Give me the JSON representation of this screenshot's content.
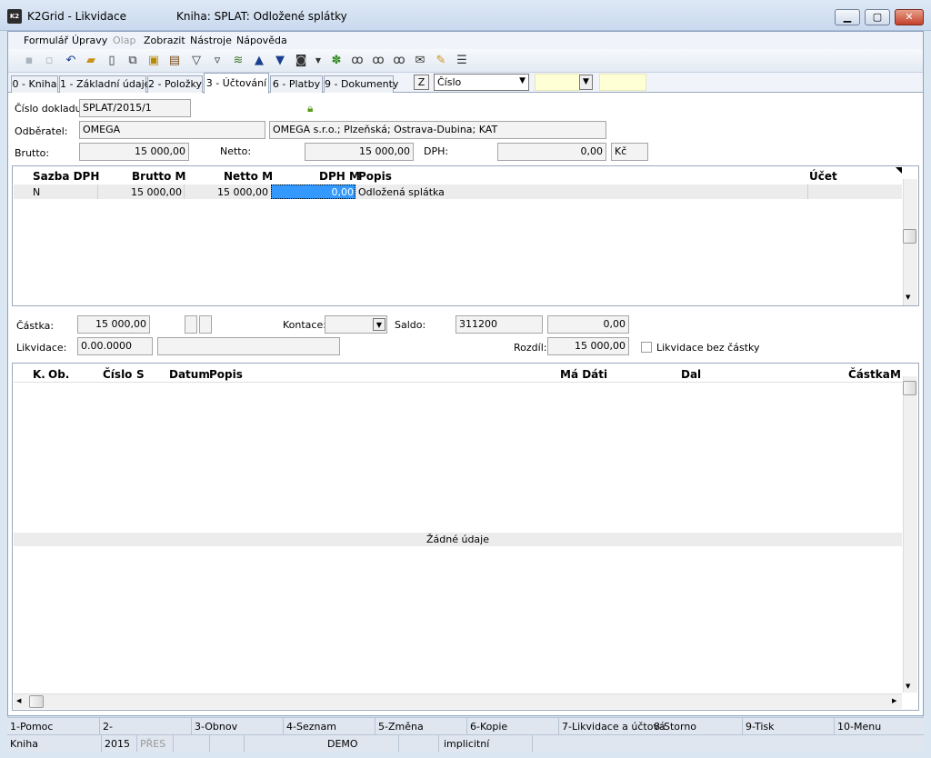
{
  "window": {
    "app_title": "K2Grid - Likvidace",
    "doc_title": "Kniha: SPLAT: Odložené splátky",
    "app_icon_text": "K2"
  },
  "menu": [
    "Formulář",
    "Úpravy",
    "Olap",
    "Zobrazit",
    "Nástroje",
    "Nápověda"
  ],
  "toolbar_icons": [
    "save-icon",
    "save-as-icon",
    "undo-icon",
    "open-icon",
    "new-icon",
    "copy-icon",
    "lock-icon",
    "book-icon",
    "filter-icon",
    "filter-doc-icon",
    "stack-icon",
    "arrow-up-icon",
    "arrow-down-icon",
    "camera-icon",
    "dropdown-icon",
    "plant-icon",
    "binoculars-icon",
    "binoculars-next-icon",
    "binoculars-settings-icon",
    "mail-icon",
    "notes-icon",
    "menu-lines-icon"
  ],
  "tabs": {
    "t0": "0 - Kniha",
    "t1": "1 - Základní údaje",
    "t2": "2 - Položky",
    "t3": "3 - Účtování",
    "t6": "6 - Platby",
    "t9": "9 - Dokumenty",
    "z_button": "Z",
    "sort_select": "Číslo"
  },
  "header": {
    "doc_number_label": "Číslo dokladu:",
    "doc_number": "SPLAT/2015/1",
    "customer_label": "Odběratel:",
    "customer_code": "OMEGA",
    "customer_name": "OMEGA s.r.o.; Plzeňská; Ostrava-Dubina; KAT",
    "brutto_label": "Brutto:",
    "brutto": "15 000,00",
    "netto_label": "Netto:",
    "netto": "15 000,00",
    "dph_label": "DPH:",
    "dph": "0,00",
    "currency": "Kč"
  },
  "grid1": {
    "columns": [
      "Sazba DPH",
      "Brutto M",
      "Netto M",
      "DPH M",
      "Popis",
      "Účet"
    ],
    "rows": [
      {
        "sazba": "N",
        "brutto": "15 000,00",
        "netto": "15 000,00",
        "dph": "0,00",
        "popis": "Odložená splátka",
        "ucet": ""
      }
    ]
  },
  "liquidation": {
    "castka_label": "Částka:",
    "castka": "15 000,00",
    "kontace_label": "Kontace:",
    "saldo_label": "Saldo:",
    "saldo_account": "311200",
    "saldo_value": "0,00",
    "likvidace_label": "Likvidace:",
    "likvidace": "0.00.0000",
    "rozdil_label": "Rozdíl:",
    "rozdil": "15 000,00",
    "checkbox_label": "Likvidace bez částky"
  },
  "grid2": {
    "columns": [
      "K.",
      "Ob.",
      "Číslo",
      "S",
      "Datum",
      "Popis",
      "Má Dáti",
      "Dal",
      "Částka",
      "M"
    ],
    "empty_text": "Žádné údaje"
  },
  "fkeys": [
    "1-Pomoc",
    "2-",
    "3-Obnov",
    "4-Seznam",
    "5-Změna",
    "6-Kopie",
    "7-Likvidace a účtová",
    "8-Storno",
    "9-Tisk",
    "10-Menu"
  ],
  "status": {
    "book": "Kniha",
    "year": "2015",
    "mode": "PŘES",
    "company": "DEMO",
    "profile": "implicitní"
  }
}
